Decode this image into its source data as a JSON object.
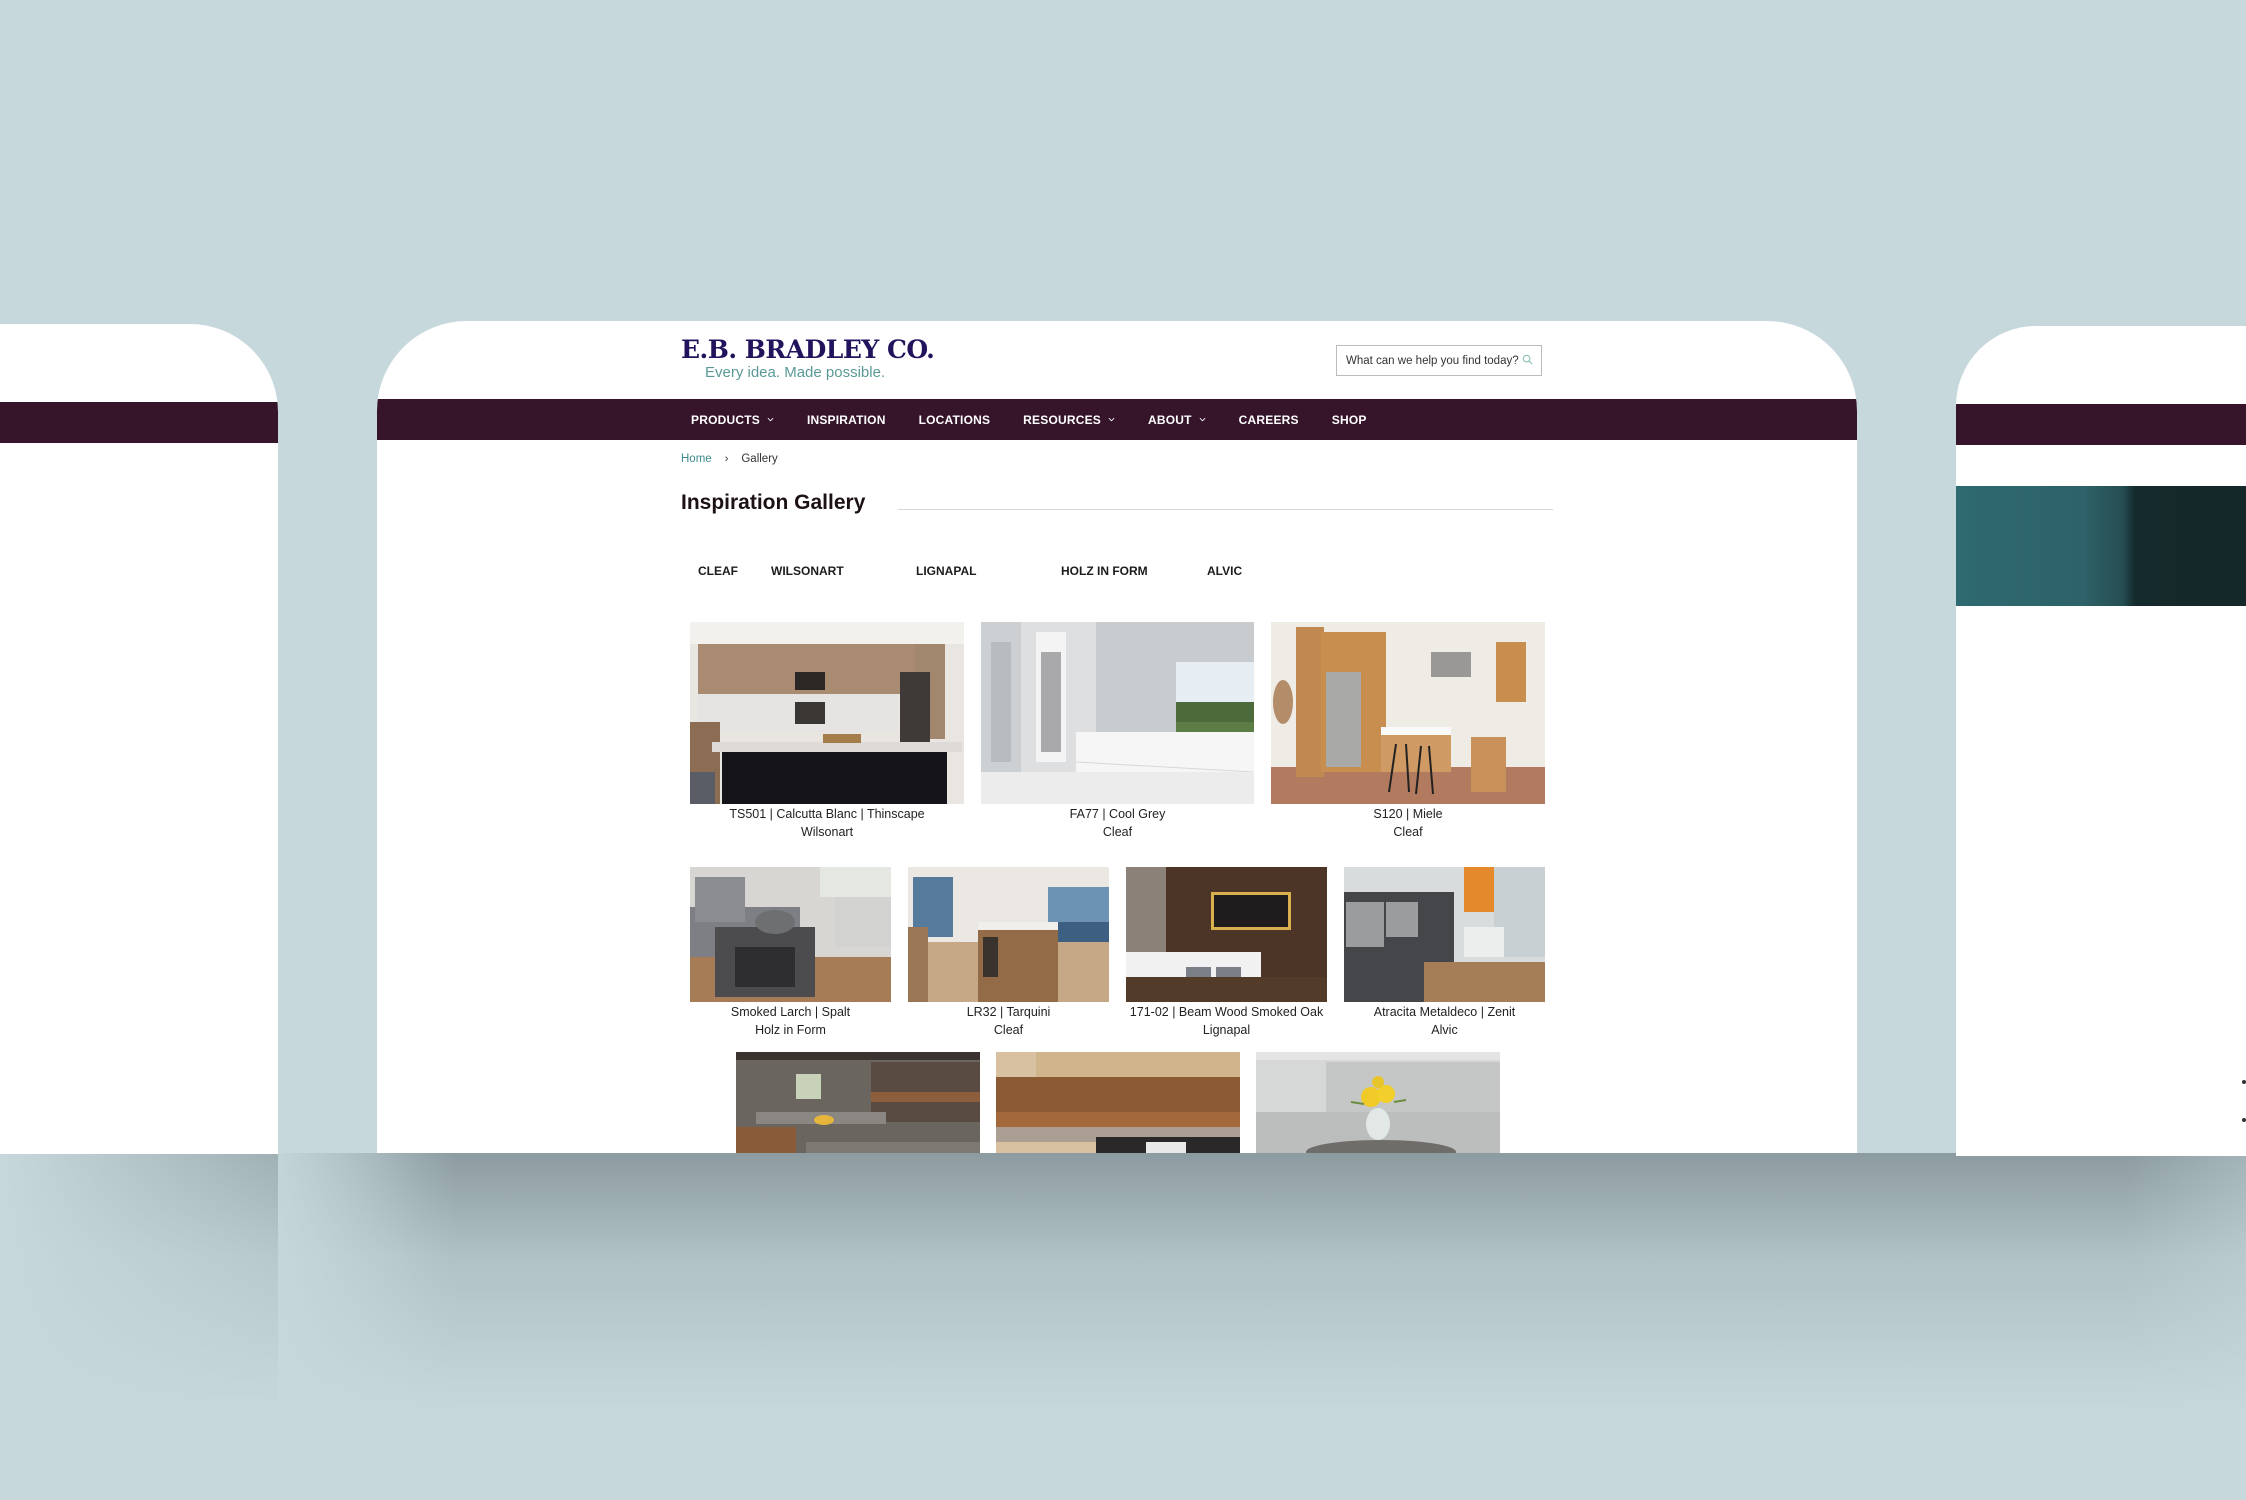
{
  "site": {
    "brand_name": "E.B. BRADLEY CO.",
    "tagline": "Every idea. Made possible.",
    "colors": {
      "nav_background": "#36152b",
      "brand_text": "#23135c",
      "accent_teal": "#5a9a96",
      "page_background": "#c6d8dc"
    }
  },
  "search": {
    "placeholder": "What can we help you find today?",
    "icon": "search-icon"
  },
  "nav": {
    "items": [
      {
        "label": "PRODUCTS",
        "has_dropdown": true
      },
      {
        "label": "INSPIRATION",
        "has_dropdown": false
      },
      {
        "label": "LOCATIONS",
        "has_dropdown": false
      },
      {
        "label": "RESOURCES",
        "has_dropdown": true
      },
      {
        "label": "ABOUT",
        "has_dropdown": true
      },
      {
        "label": "CAREERS",
        "has_dropdown": false
      },
      {
        "label": "SHOP",
        "has_dropdown": false
      }
    ]
  },
  "breadcrumb": {
    "home": "Home",
    "separator": "›",
    "current": "Gallery"
  },
  "page": {
    "title": "Inspiration Gallery"
  },
  "filters": [
    "CLEAF",
    "WILSONART",
    "LIGNAPAL",
    "HOLZ IN FORM",
    "ALVIC"
  ],
  "gallery": {
    "row1": [
      {
        "line1": "TS501 | Calcutta Blanc | Thinscape",
        "line2": "Wilsonart",
        "image": "kitchen island with black base and wood cabinets"
      },
      {
        "line1": "FA77 | Cool Grey",
        "line2": "Cleaf",
        "image": "white bathroom vanity with mirror and window"
      },
      {
        "line1": "S120 | Miele",
        "line2": "Cleaf",
        "image": "wood kitchen with open shelving and bar stools"
      }
    ],
    "row2": [
      {
        "line1": "Smoked Larch | Spalt",
        "line2": "Holz in Form",
        "image": "grey sofa with dark side table"
      },
      {
        "line1": "LR32 | Tarquini",
        "line2": "Cleaf",
        "image": "wood kitchen island with city view"
      },
      {
        "line1": "171-02 | Beam Wood Smoked Oak",
        "line2": "Lignapal",
        "image": "dark wood wall with ovens and white counter"
      },
      {
        "line1": "Atracita Metaldeco | Zenit",
        "line2": "Alvic",
        "image": "dark grey kitchen with ovens and orange wall"
      }
    ],
    "row3": [
      {
        "image": "bar with bottles and counter stools"
      },
      {
        "image": "wood countertop close-up"
      },
      {
        "image": "yellow flowers in vase on round table"
      }
    ]
  }
}
